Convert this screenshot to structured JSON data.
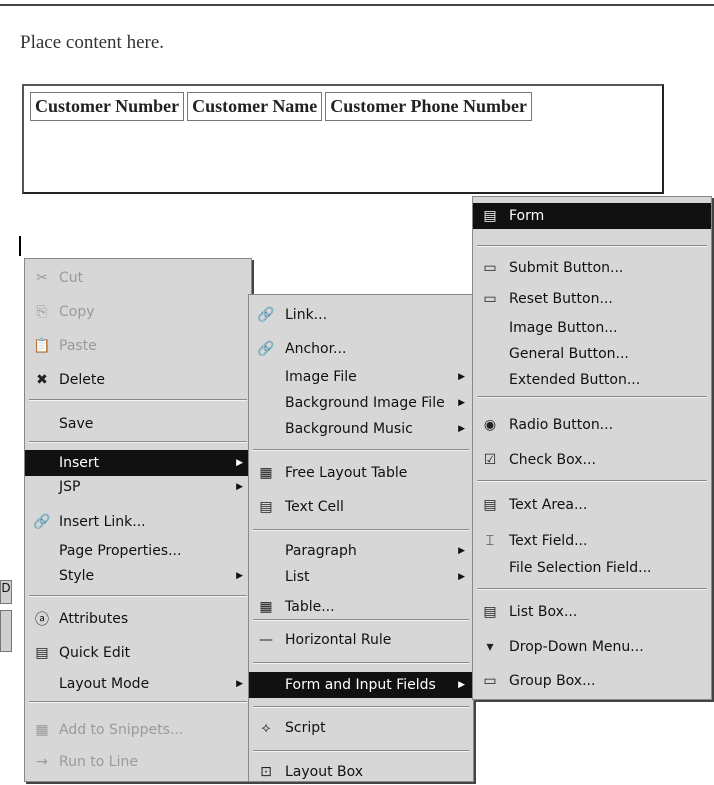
{
  "page": {
    "placeholder_text": "Place content here.",
    "table_headers": [
      "Customer Number",
      "Customer Name",
      "Customer Phone Number"
    ]
  },
  "bg_fragment": "D",
  "context_menu": {
    "items": [
      {
        "label": "Cut",
        "icon": "scissors-icon",
        "glyph": "✂",
        "disabled": true
      },
      {
        "label": "Copy",
        "icon": "copy-icon",
        "glyph": "⎘",
        "disabled": true
      },
      {
        "label": "Paste",
        "icon": "paste-icon",
        "glyph": "📋",
        "disabled": true
      },
      {
        "label": "Delete",
        "icon": "delete-icon",
        "glyph": "✖",
        "disabled": false
      },
      {
        "label": "Save",
        "icon": "",
        "glyph": "",
        "disabled": false
      },
      {
        "label": "Insert",
        "icon": "",
        "glyph": "",
        "disabled": false,
        "submenu": true,
        "selected": true
      },
      {
        "label": "JSP",
        "icon": "",
        "glyph": "",
        "disabled": false,
        "submenu": true
      },
      {
        "label": "Insert Link...",
        "icon": "link-icon",
        "glyph": "🔗",
        "disabled": false
      },
      {
        "label": "Page Properties...",
        "icon": "",
        "glyph": "",
        "disabled": false
      },
      {
        "label": "Style",
        "icon": "",
        "glyph": "",
        "disabled": false,
        "submenu": true
      },
      {
        "label": "Attributes",
        "icon": "attributes-icon",
        "glyph": "ⓐ",
        "disabled": false
      },
      {
        "label": "Quick Edit",
        "icon": "quick-edit-icon",
        "glyph": "▤",
        "disabled": false
      },
      {
        "label": "Layout Mode",
        "icon": "",
        "glyph": "",
        "disabled": false,
        "submenu": true
      },
      {
        "label": "Add to Snippets...",
        "icon": "snippets-icon",
        "glyph": "▦",
        "disabled": true
      },
      {
        "label": "Run to Line",
        "icon": "run-to-line-icon",
        "glyph": "→",
        "disabled": true
      }
    ]
  },
  "insert_menu": {
    "items": [
      {
        "label": "Link...",
        "icon": "link-icon",
        "glyph": "🔗"
      },
      {
        "label": "Anchor...",
        "icon": "anchor-icon",
        "glyph": "🔗"
      },
      {
        "label": "Image File",
        "icon": "",
        "glyph": "",
        "submenu": true
      },
      {
        "label": "Background Image File",
        "icon": "",
        "glyph": "",
        "submenu": true
      },
      {
        "label": "Background Music",
        "icon": "",
        "glyph": "",
        "submenu": true
      },
      {
        "label": "Free Layout Table",
        "icon": "free-layout-table-icon",
        "glyph": "▦"
      },
      {
        "label": "Text Cell",
        "icon": "text-cell-icon",
        "glyph": "▤"
      },
      {
        "label": "Paragraph",
        "icon": "",
        "glyph": "",
        "submenu": true
      },
      {
        "label": "List",
        "icon": "",
        "glyph": "",
        "submenu": true
      },
      {
        "label": "Table...",
        "icon": "table-icon",
        "glyph": "▦"
      },
      {
        "label": "Horizontal Rule",
        "icon": "horizontal-rule-icon",
        "glyph": "—"
      },
      {
        "label": "Form and Input Fields",
        "icon": "",
        "glyph": "",
        "submenu": true,
        "selected": true
      },
      {
        "label": "Script",
        "icon": "script-icon",
        "glyph": "⟡"
      },
      {
        "label": "Layout Box",
        "icon": "layout-box-icon",
        "glyph": "⊡"
      }
    ]
  },
  "form_menu": {
    "items": [
      {
        "label": "Form",
        "icon": "form-icon",
        "glyph": "▤",
        "selected": true
      },
      {
        "label": "Submit Button...",
        "icon": "submit-button-icon",
        "glyph": "▭"
      },
      {
        "label": "Reset Button...",
        "icon": "reset-button-icon",
        "glyph": "▭"
      },
      {
        "label": "Image Button...",
        "icon": "",
        "glyph": ""
      },
      {
        "label": "General Button...",
        "icon": "",
        "glyph": ""
      },
      {
        "label": "Extended Button...",
        "icon": "",
        "glyph": ""
      },
      {
        "label": "Radio Button...",
        "icon": "radio-button-icon",
        "glyph": "◉"
      },
      {
        "label": "Check Box...",
        "icon": "check-box-icon",
        "glyph": "☑"
      },
      {
        "label": "Text Area...",
        "icon": "text-area-icon",
        "glyph": "▤"
      },
      {
        "label": "Text Field...",
        "icon": "text-field-icon",
        "glyph": "⌶"
      },
      {
        "label": "File Selection Field...",
        "icon": "",
        "glyph": ""
      },
      {
        "label": "List Box...",
        "icon": "list-box-icon",
        "glyph": "▤"
      },
      {
        "label": "Drop-Down Menu...",
        "icon": "drop-down-menu-icon",
        "glyph": "▾"
      },
      {
        "label": "Group Box...",
        "icon": "group-box-icon",
        "glyph": "▭"
      }
    ]
  }
}
